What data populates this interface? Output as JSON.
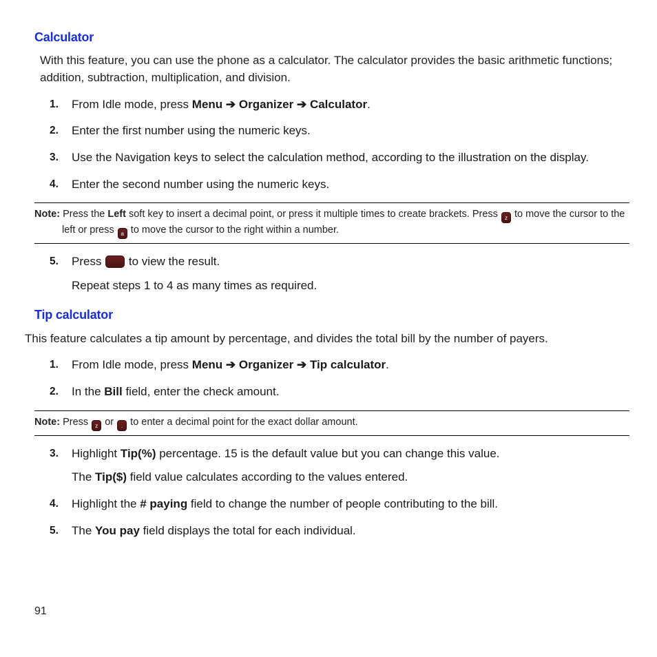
{
  "calc": {
    "heading": "Calculator",
    "intro": "With this feature, you can use the phone as a calculator. The calculator provides the basic arithmetic functions; addition, subtraction, multiplication, and division.",
    "steps": {
      "s1_pre": "From Idle mode, press ",
      "s1_menu": "Menu",
      "s1_arrow": " ➔ ",
      "s1_org": "Organizer",
      "s1_calc": "Calculator",
      "s1_post": ".",
      "s2": "Enter the first number using the numeric keys.",
      "s3": "Use the Navigation keys to select the calculation method, according to the illustration on the display.",
      "s4": "Enter the second number using the numeric keys.",
      "s5_pre": "Press ",
      "s5_post": " to view the result.",
      "s5_repeat": "Repeat steps 1 to 4 as many times as required."
    },
    "note": {
      "label": "Note:",
      "l1a": " Press the ",
      "l1b": "Left",
      "l1c": " soft key to insert a decimal point, or press it multiple times to create brackets. Press ",
      "l1d": " to move the cursor to the ",
      "l2a": "left or press ",
      "l2b": " to move the cursor to the right within a number."
    }
  },
  "tip": {
    "heading": "Tip calculator",
    "intro": "This feature calculates a tip amount by percentage, and divides the total bill by the number of payers.",
    "steps": {
      "s1_pre": "From Idle mode, press ",
      "s1_menu": "Menu",
      "s1_arrow": " ➔ ",
      "s1_org": "Organizer",
      "s1_tip": "Tip calculator",
      "s1_post": ".",
      "s2_pre": "In the ",
      "s2_b": "Bill",
      "s2_post": " field, enter the check amount.",
      "s3_pre": "Highlight ",
      "s3_b": "Tip(%)",
      "s3_mid": " percentage. 15 is the default value but you can change this value.",
      "s3b_pre": "The ",
      "s3b_b": "Tip($)",
      "s3b_post": " field value calculates according to the values entered.",
      "s4_pre": "Highlight the ",
      "s4_b": "# paying",
      "s4_post": " field to change the number of people contributing to the bill.",
      "s5_pre": "The ",
      "s5_b": "You pay",
      "s5_post": " field displays the total for each individual."
    },
    "note": {
      "label": "Note:",
      "l1a": " Press ",
      "l1b": " or ",
      "l1c": " to enter a decimal point for the exact dollar amount."
    }
  },
  "icons": {
    "star_key": "z",
    "hash_key": "a",
    "dot_key": ".",
    "ok_key": ""
  },
  "nums": {
    "n1": "1.",
    "n2": "2.",
    "n3": "3.",
    "n4": "4.",
    "n5": "5."
  },
  "page": "91"
}
